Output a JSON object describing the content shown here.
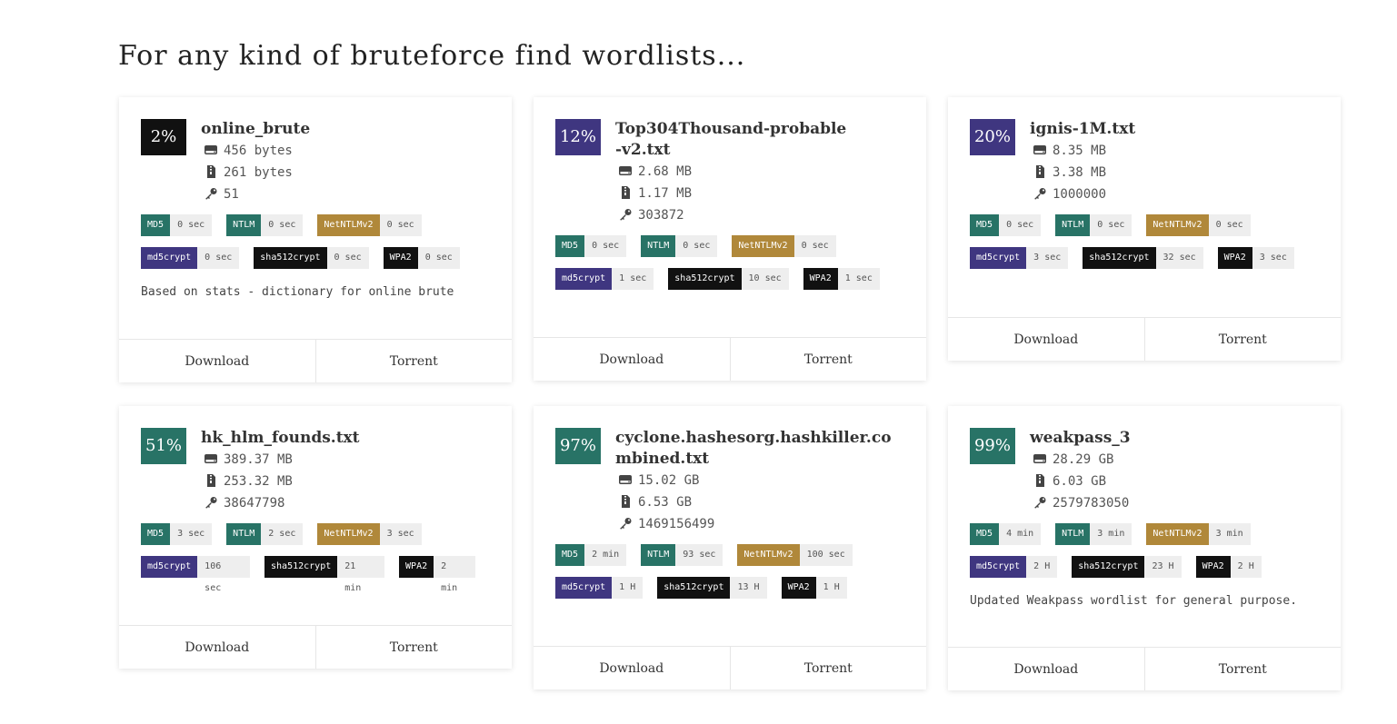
{
  "page_title": "For any kind of bruteforce find wordlists...",
  "colors": {
    "dark": "#111111",
    "purple": "#3f3680",
    "teal": "#287366",
    "gold": "#b0883a"
  },
  "icons": {
    "size": "hdd-icon",
    "compressed": "file-zip-icon",
    "count": "key-icon"
  },
  "buttons": {
    "download": "Download",
    "torrent": "Torrent"
  },
  "wordlists": [
    {
      "percent": "2%",
      "name": "online_brute",
      "size": "456 bytes",
      "compressed": "261 bytes",
      "count": "51",
      "badges": [
        [
          "MD5",
          "0 sec"
        ],
        [
          "NTLM",
          "0 sec"
        ],
        [
          "NetNTLMv2",
          "0 sec"
        ],
        [
          "md5crypt",
          "0 sec"
        ],
        [
          "sha512crypt",
          "0 sec"
        ],
        [
          "WPA2",
          "0 sec"
        ]
      ],
      "description": "Based on stats - dictionary for online brute"
    },
    {
      "percent": "12%",
      "name": "Top304Thousand-probable-v2.txt",
      "size": "2.68 MB",
      "compressed": "1.17 MB",
      "count": "303872",
      "badges": [
        [
          "MD5",
          "0 sec"
        ],
        [
          "NTLM",
          "0 sec"
        ],
        [
          "NetNTLMv2",
          "0 sec"
        ],
        [
          "md5crypt",
          "1 sec"
        ],
        [
          "sha512crypt",
          "10 sec"
        ],
        [
          "WPA2",
          "1 sec"
        ]
      ],
      "description": ""
    },
    {
      "percent": "20%",
      "name": "ignis-1M.txt",
      "size": "8.35 MB",
      "compressed": "3.38 MB",
      "count": "1000000",
      "badges": [
        [
          "MD5",
          "0 sec"
        ],
        [
          "NTLM",
          "0 sec"
        ],
        [
          "NetNTLMv2",
          "0 sec"
        ],
        [
          "md5crypt",
          "3 sec"
        ],
        [
          "sha512crypt",
          "32 sec"
        ],
        [
          "WPA2",
          "3 sec"
        ]
      ],
      "description": ""
    },
    {
      "percent": "51%",
      "name": "hk_hlm_founds.txt",
      "size": "389.37 MB",
      "compressed": "253.32 MB",
      "count": "38647798",
      "badges": [
        [
          "MD5",
          "3 sec"
        ],
        [
          "NTLM",
          "2 sec"
        ],
        [
          "NetNTLMv2",
          "3 sec"
        ],
        [
          "md5crypt",
          "106 sec"
        ],
        [
          "sha512crypt",
          "21 min"
        ],
        [
          "WPA2",
          "2 min"
        ]
      ],
      "description": ""
    },
    {
      "percent": "97%",
      "name": "cyclone.hashesorg.hashkiller.combined.txt",
      "size": "15.02 GB",
      "compressed": "6.53 GB",
      "count": "1469156499",
      "badges": [
        [
          "MD5",
          "2 min"
        ],
        [
          "NTLM",
          "93 sec"
        ],
        [
          "NetNTLMv2",
          "100 sec"
        ],
        [
          "md5crypt",
          "1 H"
        ],
        [
          "sha512crypt",
          "13 H"
        ],
        [
          "WPA2",
          "1 H"
        ]
      ],
      "description": ""
    },
    {
      "percent": "99%",
      "name": "weakpass_3",
      "size": "28.29 GB",
      "compressed": "6.03 GB",
      "count": "2579783050",
      "badges": [
        [
          "MD5",
          "4 min"
        ],
        [
          "NTLM",
          "3 min"
        ],
        [
          "NetNTLMv2",
          "3 min"
        ],
        [
          "md5crypt",
          "2 H"
        ],
        [
          "sha512crypt",
          "23 H"
        ],
        [
          "WPA2",
          "2 H"
        ]
      ],
      "description": "Updated Weakpass wordlist for general purpose."
    }
  ]
}
